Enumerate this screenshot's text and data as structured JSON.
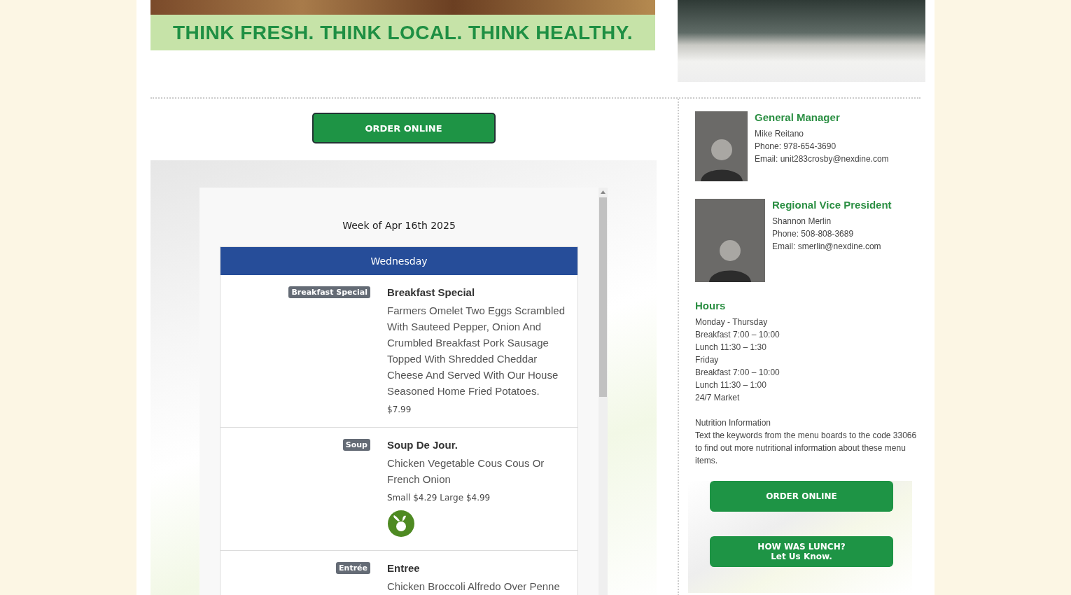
{
  "banner": {
    "slogan": "THINK FRESH. THINK LOCAL. THINK HEALTHY."
  },
  "order_button": "ORDER ONLINE",
  "menu": {
    "week": "Week of Apr 16th 2025",
    "day": "Wednesday",
    "items": [
      {
        "badge": "Breakfast Special",
        "title": "Breakfast Special",
        "description": "Farmers Omelet Two Eggs Scrambled With Sauteed Pepper, Onion And Crumbled Breakfast Pork Sausage Topped With Shredded Cheddar Cheese And Served With Our House Seasoned Home Fried Potatoes.",
        "price": "$7.99",
        "vegetarian": false
      },
      {
        "badge": "Soup",
        "title": "Soup De Jour.",
        "description": "Chicken Vegetable Cous Cous Or French Onion",
        "price": "Small $4.29 Large $4.99",
        "vegetarian": true
      },
      {
        "badge": "Entrée",
        "title": "Entree",
        "description": "Chicken Broccoli Alfredo Over Penne",
        "vegetarian": false
      }
    ]
  },
  "contacts": [
    {
      "role": "General Manager",
      "name": "Mike Reitano",
      "phone": "Phone: 978-654-3690",
      "email": "Email: unit283crosby@nexdine.com"
    },
    {
      "role": "Regional Vice President",
      "name": "Shannon Merlin",
      "phone": "Phone: 508-808-3689",
      "email": "Email: smerlin@nexdine.com"
    }
  ],
  "hours": {
    "title": "Hours",
    "lines": [
      "Monday - Thursday",
      "Breakfast 7:00 – 10:00",
      "Lunch 11:30 – 1:30",
      "Friday",
      "Breakfast 7:00 – 10:00",
      "Lunch 11:30 – 1:00",
      "24/7 Market"
    ]
  },
  "nutrition": {
    "title": "Nutrition Information",
    "text": "Text the keywords from the menu boards to the code 33066 to find out more nutritional information about these menu items."
  },
  "side_buttons": [
    {
      "lines": [
        "ORDER ONLINE"
      ]
    },
    {
      "lines": [
        "HOW WAS LUNCH?",
        "Let Us Know."
      ]
    }
  ]
}
